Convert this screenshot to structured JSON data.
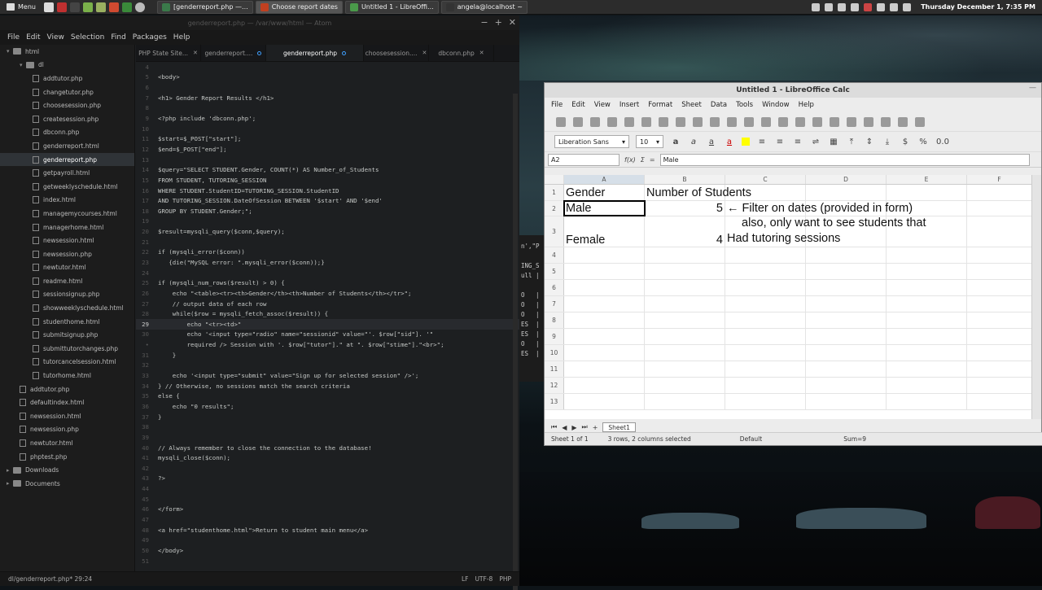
{
  "taskbar": {
    "menu_label": "Menu",
    "tasks": [
      {
        "label": "[genderreport.php —...",
        "color": "#3a7a4a",
        "active": false
      },
      {
        "label": "Choose report dates",
        "color": "#c04020",
        "active": true
      },
      {
        "label": "Untitled 1 - LibreOffi...",
        "color": "#4a9a4a",
        "active": false
      },
      {
        "label": "angela@localhost ~",
        "color": "#333333",
        "active": false
      }
    ],
    "clock": "Thursday December  1,  7:35 PM"
  },
  "atom": {
    "title": "genderreport.php — /var/www/html — Atom",
    "menu": [
      "File",
      "Edit",
      "View",
      "Selection",
      "Find",
      "Packages",
      "Help"
    ],
    "tree": [
      {
        "label": "html",
        "type": "folder",
        "depth": 0,
        "open": true
      },
      {
        "label": "dl",
        "type": "folder",
        "depth": 1,
        "open": true
      },
      {
        "label": "addtutor.php",
        "type": "file",
        "depth": 2
      },
      {
        "label": "changetutor.php",
        "type": "file",
        "depth": 2
      },
      {
        "label": "choosesession.php",
        "type": "file",
        "depth": 2
      },
      {
        "label": "createsession.php",
        "type": "file",
        "depth": 2
      },
      {
        "label": "dbconn.php",
        "type": "file",
        "depth": 2
      },
      {
        "label": "genderreport.html",
        "type": "file",
        "depth": 2
      },
      {
        "label": "genderreport.php",
        "type": "file",
        "depth": 2,
        "selected": true
      },
      {
        "label": "getpayroll.html",
        "type": "file",
        "depth": 2
      },
      {
        "label": "getweeklyschedule.html",
        "type": "file",
        "depth": 2
      },
      {
        "label": "index.html",
        "type": "file",
        "depth": 2
      },
      {
        "label": "managemycourses.html",
        "type": "file",
        "depth": 2
      },
      {
        "label": "managerhome.html",
        "type": "file",
        "depth": 2
      },
      {
        "label": "newsession.html",
        "type": "file",
        "depth": 2
      },
      {
        "label": "newsession.php",
        "type": "file",
        "depth": 2
      },
      {
        "label": "newtutor.html",
        "type": "file",
        "depth": 2
      },
      {
        "label": "readme.html",
        "type": "file",
        "depth": 2
      },
      {
        "label": "sessionsignup.php",
        "type": "file",
        "depth": 2
      },
      {
        "label": "showweeklyschedule.html",
        "type": "file",
        "depth": 2
      },
      {
        "label": "studenthome.html",
        "type": "file",
        "depth": 2
      },
      {
        "label": "submitsignup.php",
        "type": "file",
        "depth": 2
      },
      {
        "label": "submittutorchanges.php",
        "type": "file",
        "depth": 2
      },
      {
        "label": "tutorcancelsession.html",
        "type": "file",
        "depth": 2
      },
      {
        "label": "tutorhome.html",
        "type": "file",
        "depth": 2
      },
      {
        "label": "addtutor.php",
        "type": "file",
        "depth": 1
      },
      {
        "label": "defaultindex.html",
        "type": "file",
        "depth": 1
      },
      {
        "label": "newsession.html",
        "type": "file",
        "depth": 1
      },
      {
        "label": "newsession.php",
        "type": "file",
        "depth": 1
      },
      {
        "label": "newtutor.html",
        "type": "file",
        "depth": 1
      },
      {
        "label": "phptest.php",
        "type": "file",
        "depth": 1
      },
      {
        "label": "Downloads",
        "type": "folder",
        "depth": 0,
        "open": false
      },
      {
        "label": "Documents",
        "type": "folder",
        "depth": 0,
        "open": false
      }
    ],
    "tabs": [
      {
        "label": "PHP State Site...",
        "active": false,
        "mod": false
      },
      {
        "label": "genderreport....",
        "active": false,
        "mod": true
      },
      {
        "label": "genderreport.php",
        "active": true,
        "mod": true
      },
      {
        "label": "choosesession....",
        "active": false,
        "mod": false
      },
      {
        "label": "dbconn.php",
        "active": false,
        "mod": false
      }
    ],
    "current_line": "29",
    "code": [
      {
        "n": "4",
        "t": ""
      },
      {
        "n": "5",
        "t": "<body>"
      },
      {
        "n": "6",
        "t": ""
      },
      {
        "n": "7",
        "t": "<h1> Gender Report Results </h1>"
      },
      {
        "n": "8",
        "t": ""
      },
      {
        "n": "9",
        "t": "<?php include 'dbconn.php';"
      },
      {
        "n": "10",
        "t": ""
      },
      {
        "n": "11",
        "t": "$start=$_POST[\"start\"];"
      },
      {
        "n": "12",
        "t": "$end=$_POST[\"end\"];"
      },
      {
        "n": "13",
        "t": ""
      },
      {
        "n": "14",
        "t": "$query=\"SELECT STUDENT.Gender, COUNT(*) AS Number_of_Students"
      },
      {
        "n": "15",
        "t": "FROM STUDENT, TUTORING_SESSION"
      },
      {
        "n": "16",
        "t": "WHERE STUDENT.StudentID=TUTORING_SESSION.StudentID"
      },
      {
        "n": "17",
        "t": "AND TUTORING_SESSION.DateOfSession BETWEEN '$start' AND '$end'"
      },
      {
        "n": "18",
        "t": "GROUP BY STUDENT.Gender;\";"
      },
      {
        "n": "19",
        "t": ""
      },
      {
        "n": "20",
        "t": "$result=mysqli_query($conn,$query);"
      },
      {
        "n": "21",
        "t": ""
      },
      {
        "n": "22",
        "t": "if (mysqli_error($conn))"
      },
      {
        "n": "23",
        "t": "   {die(\"MySQL error: \".mysqli_error($conn));}"
      },
      {
        "n": "24",
        "t": ""
      },
      {
        "n": "25",
        "t": "if (mysqli_num_rows($result) > 0) {"
      },
      {
        "n": "26",
        "t": "    echo \"<table><tr><th>Gender</th><th>Number of Students</th></tr>\";"
      },
      {
        "n": "27",
        "t": "    // output data of each row"
      },
      {
        "n": "28",
        "t": "    while($row = mysqli_fetch_assoc($result)) {"
      },
      {
        "n": "29",
        "t": "        echo \"<tr><td>\""
      },
      {
        "n": "30",
        "t": "        echo '<input type=\"radio\" name=\"sessionid\" value=\"'. $row[\"sid\"]. '\""
      },
      {
        "n": "•",
        "t": "        required /> Session with '. $row[\"tutor\"].\" at \". $row[\"stime\"].\"<br>\";"
      },
      {
        "n": "31",
        "t": "    }"
      },
      {
        "n": "32",
        "t": ""
      },
      {
        "n": "33",
        "t": "    echo '<input type=\"submit\" value=\"Sign up for selected session\" />';"
      },
      {
        "n": "34",
        "t": "} // Otherwise, no sessions match the search criteria"
      },
      {
        "n": "35",
        "t": "else {"
      },
      {
        "n": "36",
        "t": "    echo \"0 results\";"
      },
      {
        "n": "37",
        "t": "}"
      },
      {
        "n": "38",
        "t": ""
      },
      {
        "n": "39",
        "t": ""
      },
      {
        "n": "40",
        "t": "// Always remember to close the connection to the database!"
      },
      {
        "n": "41",
        "t": "mysqli_close($conn);"
      },
      {
        "n": "42",
        "t": ""
      },
      {
        "n": "43",
        "t": "?>"
      },
      {
        "n": "44",
        "t": ""
      },
      {
        "n": "45",
        "t": ""
      },
      {
        "n": "46",
        "t": "</form>"
      },
      {
        "n": "47",
        "t": ""
      },
      {
        "n": "48",
        "t": "<a href=\"studenthome.html\">Return to student main menu</a>"
      },
      {
        "n": "49",
        "t": ""
      },
      {
        "n": "50",
        "t": "</body>"
      },
      {
        "n": "51",
        "t": ""
      }
    ],
    "status_left": "dl/genderreport.php*   29:24",
    "status_right": [
      "LF",
      "UTF-8",
      "PHP"
    ]
  },
  "terminal_fragment": "n',\"P\n\nING_S\null |\n\nO   |\nO   |\nO   |\nES  |\nES  |\nO   |\nES  |",
  "calc": {
    "title": "Untitled 1 - LibreOffice Calc",
    "menu": [
      "File",
      "Edit",
      "View",
      "Insert",
      "Format",
      "Sheet",
      "Data",
      "Tools",
      "Window",
      "Help"
    ],
    "font_name": "Liberation Sans",
    "font_size": "10",
    "name_box": "A2",
    "formula": "Male",
    "columns": [
      "A",
      "B",
      "C",
      "D",
      "E",
      "F"
    ],
    "rows": [
      {
        "n": "1",
        "a": "Gender",
        "b": "Number of Students",
        "note": ""
      },
      {
        "n": "2",
        "a": "Male",
        "b": "5",
        "note": "← Filter on dates (provided in form)"
      },
      {
        "n": "3",
        "a": "Female",
        "b": "4",
        "note": "also, only want to see students that"
      },
      {
        "n": "4",
        "a": "",
        "b": "",
        "note": ""
      },
      {
        "n": "5",
        "a": "",
        "b": "",
        "note": ""
      },
      {
        "n": "6",
        "a": "",
        "b": "",
        "note": ""
      },
      {
        "n": "7",
        "a": "",
        "b": "",
        "note": ""
      },
      {
        "n": "8",
        "a": "",
        "b": "",
        "note": ""
      },
      {
        "n": "9",
        "a": "",
        "b": "",
        "note": ""
      },
      {
        "n": "10",
        "a": "",
        "b": "",
        "note": ""
      },
      {
        "n": "11",
        "a": "",
        "b": "",
        "note": ""
      },
      {
        "n": "12",
        "a": "",
        "b": "",
        "note": ""
      },
      {
        "n": "13",
        "a": "",
        "b": "",
        "note": ""
      }
    ],
    "note_line3b": "Had tutoring sessions",
    "sheet_tab": "Sheet1",
    "status": {
      "sheet": "Sheet 1 of 1",
      "selection": "3 rows, 2 columns selected",
      "style": "Default",
      "sum": "Sum=9"
    }
  }
}
